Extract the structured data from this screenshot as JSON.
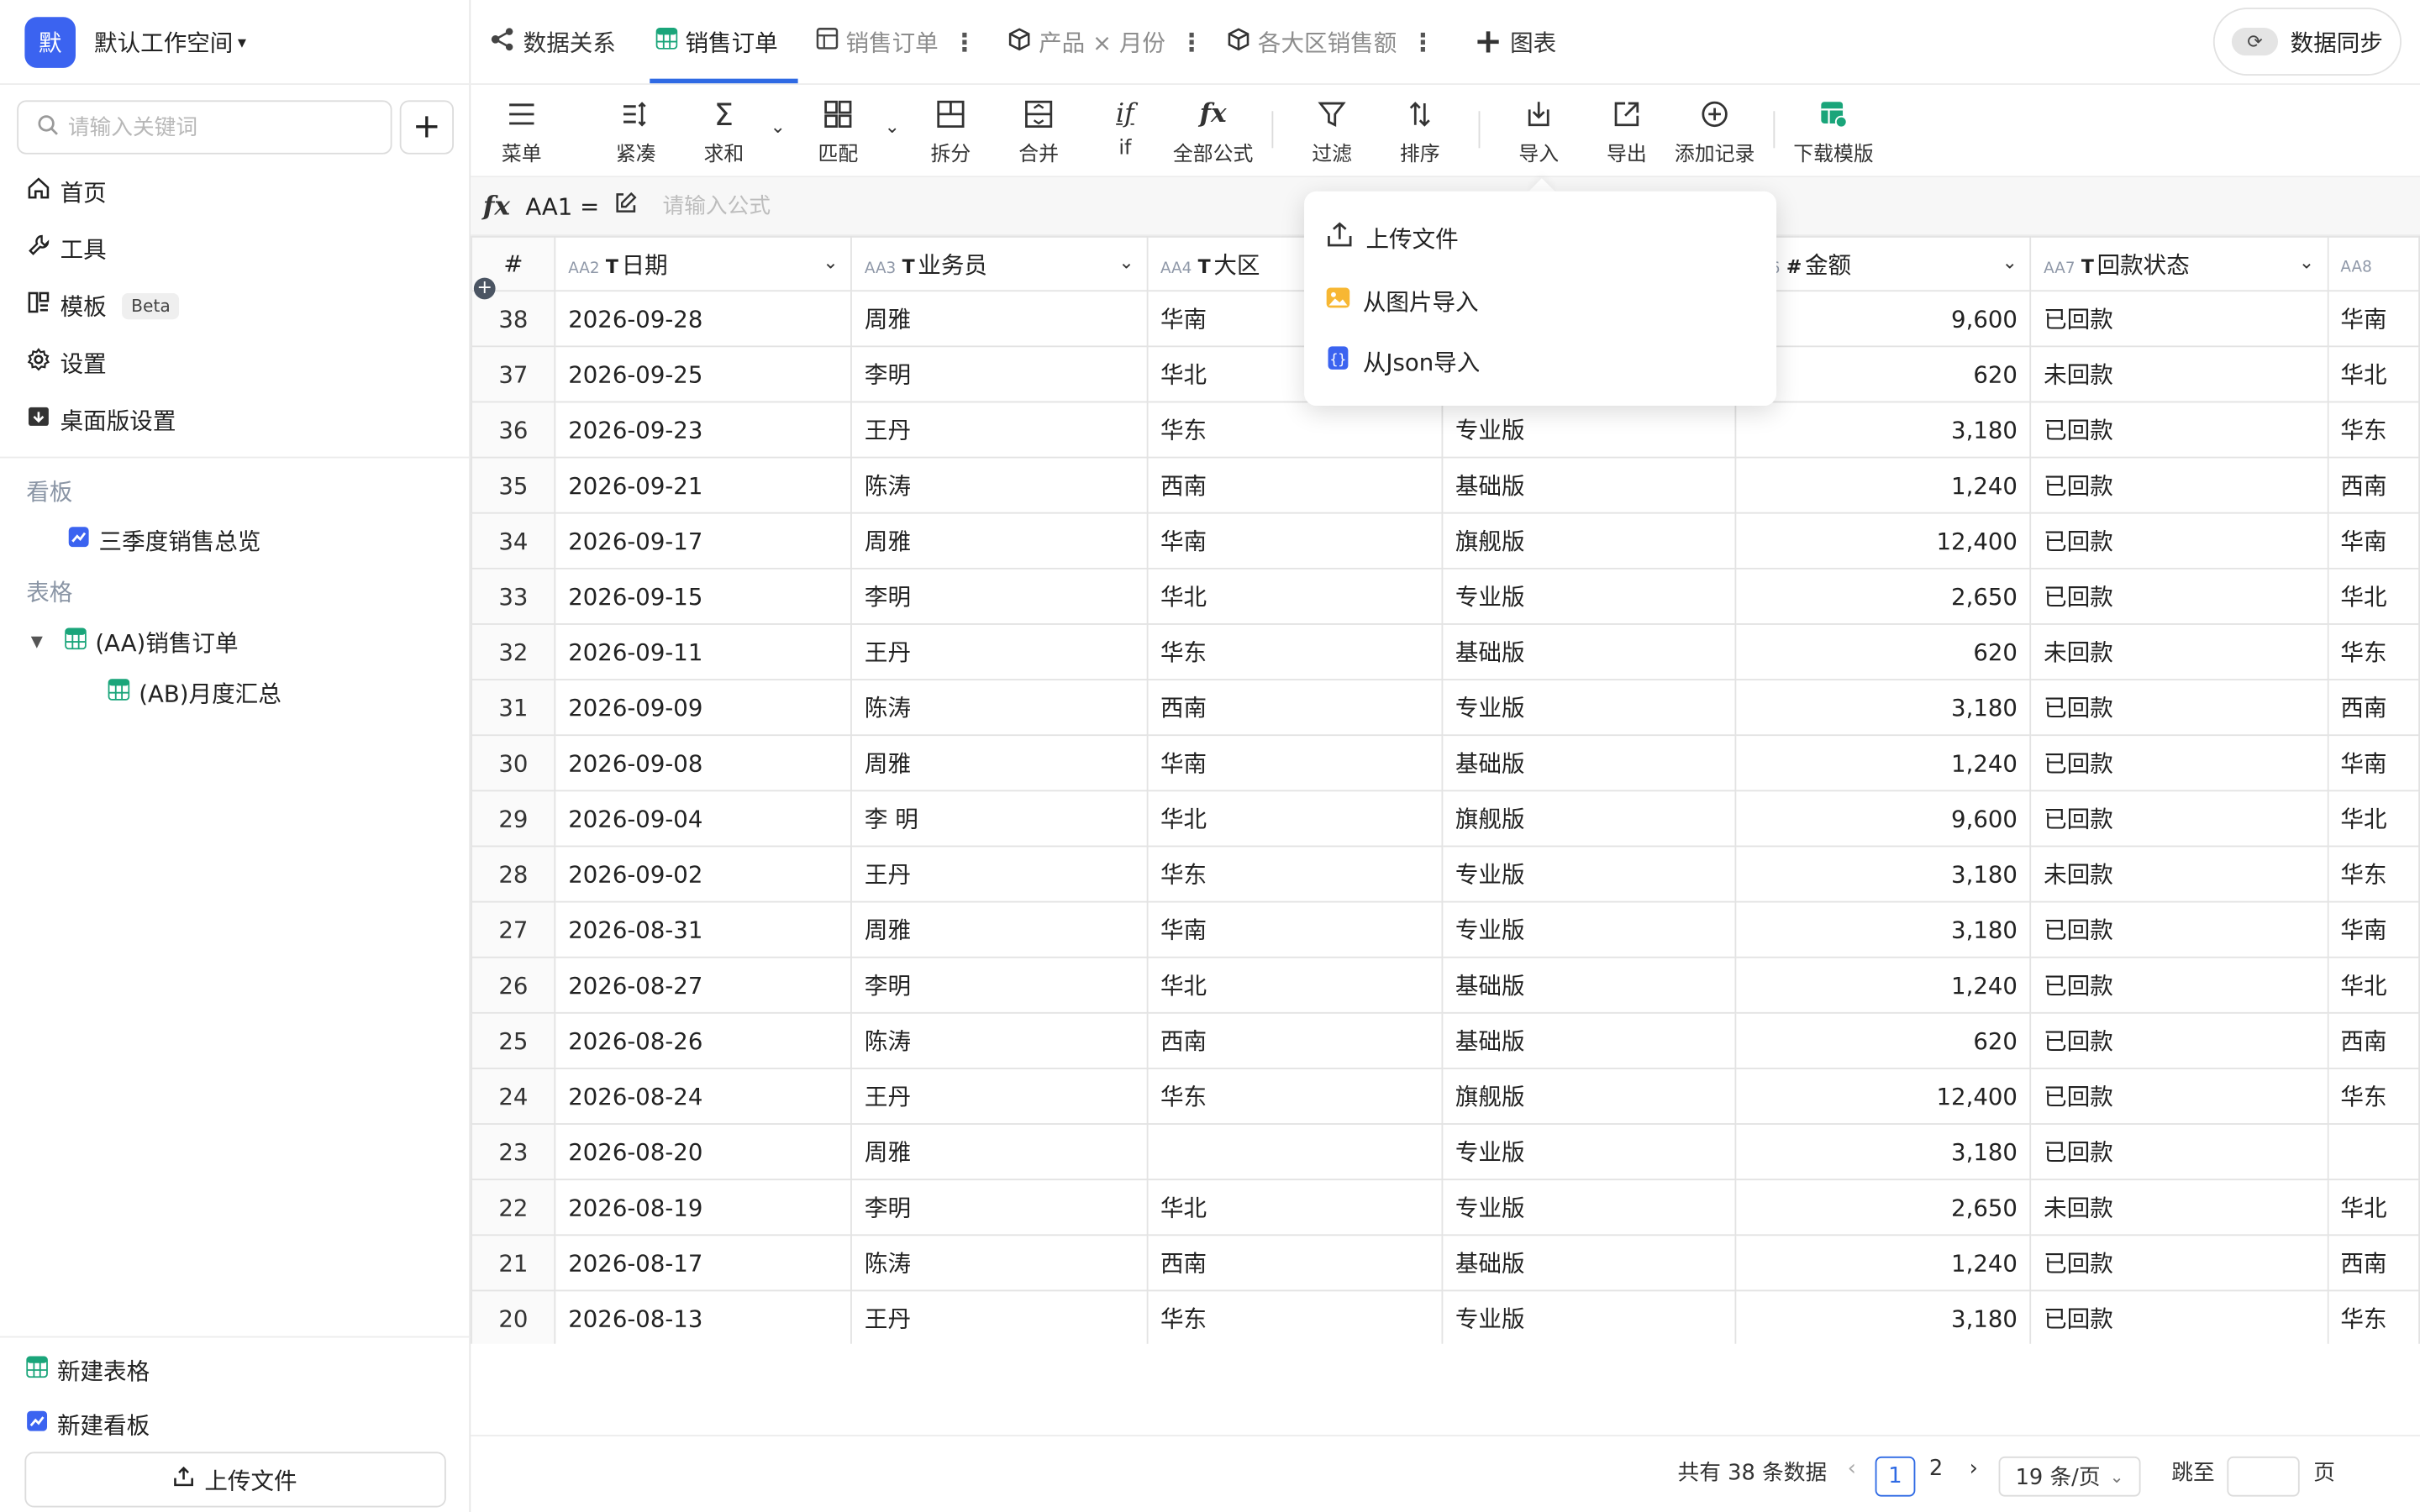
{
  "workspace": {
    "avatar": "默",
    "name": "默认工作空间"
  },
  "search": {
    "placeholder": "请输入关键词"
  },
  "nav": [
    {
      "icon": "home-icon",
      "label": "首页"
    },
    {
      "icon": "wrench-icon",
      "label": "工具"
    },
    {
      "icon": "template-icon",
      "label": "模板",
      "badge": "Beta"
    },
    {
      "icon": "gear-icon",
      "label": "设置"
    },
    {
      "icon": "desktop-settings-icon",
      "label": "桌面版设置"
    }
  ],
  "sections": {
    "boards_title": "看板",
    "boards": [
      {
        "label": "三季度销售总览"
      }
    ],
    "tables_title": "表格",
    "tables": [
      {
        "label": "(AA)销售订单"
      },
      {
        "label": "(AB)月度汇总"
      }
    ]
  },
  "sidebar_bottom": {
    "new_table": "新建表格",
    "new_board": "新建看板",
    "upload": "上传文件"
  },
  "tabs": [
    {
      "label": "数据关系",
      "icon": "relation-icon"
    },
    {
      "label": "销售订单",
      "icon": "table-icon",
      "active": true
    },
    {
      "label": "销售订单",
      "icon": "view-icon"
    },
    {
      "label": "产品 × 月份",
      "icon": "cube-icon"
    },
    {
      "label": "各大区销售额",
      "icon": "cube-icon"
    },
    {
      "label": "图表",
      "icon": "plus-icon"
    }
  ],
  "sync_label": "数据同步",
  "toolbar": [
    {
      "label": "菜单",
      "icon": "menu-icon"
    },
    {
      "label": "紧凑",
      "icon": "compact-icon"
    },
    {
      "label": "求和",
      "icon": "sum-icon"
    },
    {
      "label": "匹配",
      "icon": "match-icon"
    },
    {
      "label": "拆分",
      "icon": "split-icon"
    },
    {
      "label": "合并",
      "icon": "merge-icon"
    },
    {
      "label": "if",
      "icon": "if-icon"
    },
    {
      "label": "全部公式",
      "icon": "fx-icon"
    },
    {
      "label": "过滤",
      "icon": "filter-icon"
    },
    {
      "label": "排序",
      "icon": "sort-icon"
    },
    {
      "label": "导入",
      "icon": "import-icon"
    },
    {
      "label": "导出",
      "icon": "export-icon"
    },
    {
      "label": "添加记录",
      "icon": "add-record-icon"
    },
    {
      "label": "下载模版",
      "icon": "download-template-icon"
    }
  ],
  "formula": {
    "cell": "AA1 =",
    "placeholder": "请输入公式"
  },
  "columns": [
    {
      "id": "AA2",
      "type": "T",
      "name": "日期"
    },
    {
      "id": "AA3",
      "type": "T",
      "name": "业务员"
    },
    {
      "id": "AA4",
      "type": "T",
      "name": "大区"
    },
    {
      "id": "",
      "type": "",
      "name": ""
    },
    {
      "id": "AA6",
      "type": "#",
      "name": "金额"
    },
    {
      "id": "AA7",
      "type": "T",
      "name": "回款状态"
    },
    {
      "id": "AA8",
      "type": "",
      "name": ""
    }
  ],
  "rows": [
    [
      "38",
      "2026-09-28",
      "周雅",
      "华南",
      "",
      "9,600",
      "已回款",
      "华南"
    ],
    [
      "37",
      "2026-09-25",
      "李明",
      "华北",
      "",
      "620",
      "未回款",
      "华北"
    ],
    [
      "36",
      "2026-09-23",
      "王丹",
      "华东",
      "专业版",
      "3,180",
      "已回款",
      "华东"
    ],
    [
      "35",
      "2026-09-21",
      "陈涛",
      "西南",
      "基础版",
      "1,240",
      "已回款",
      "西南"
    ],
    [
      "34",
      "2026-09-17",
      "周雅",
      "华南",
      "旗舰版",
      "12,400",
      "已回款",
      "华南"
    ],
    [
      "33",
      "2026-09-15",
      "李明",
      "华北",
      "专业版",
      "2,650",
      "已回款",
      "华北"
    ],
    [
      "32",
      "2026-09-11",
      "王丹",
      "华东",
      "基础版",
      "620",
      "未回款",
      "华东"
    ],
    [
      "31",
      "2026-09-09",
      "陈涛",
      "西南",
      "专业版",
      "3,180",
      "已回款",
      "西南"
    ],
    [
      "30",
      "2026-09-08",
      "周雅",
      "华南",
      "基础版",
      "1,240",
      "已回款",
      "华南"
    ],
    [
      "29",
      "2026-09-04",
      "李 明",
      "华北",
      "旗舰版",
      "9,600",
      "已回款",
      "华北"
    ],
    [
      "28",
      "2026-09-02",
      "王丹",
      "华东",
      "专业版",
      "3,180",
      "未回款",
      "华东"
    ],
    [
      "27",
      "2026-08-31",
      "周雅",
      "华南",
      "专业版",
      "3,180",
      "已回款",
      "华南"
    ],
    [
      "26",
      "2026-08-27",
      "李明",
      "华北",
      "基础版",
      "1,240",
      "已回款",
      "华北"
    ],
    [
      "25",
      "2026-08-26",
      "陈涛",
      "西南",
      "基础版",
      "620",
      "已回款",
      "西南"
    ],
    [
      "24",
      "2026-08-24",
      "王丹",
      "华东",
      "旗舰版",
      "12,400",
      "已回款",
      "华东"
    ],
    [
      "23",
      "2026-08-20",
      "周雅",
      "",
      "专业版",
      "3,180",
      "已回款",
      ""
    ],
    [
      "22",
      "2026-08-19",
      "李明",
      "华北",
      "专业版",
      "2,650",
      "未回款",
      "华北"
    ],
    [
      "21",
      "2026-08-17",
      "陈涛",
      "西南",
      "基础版",
      "1,240",
      "已回款",
      "西南"
    ],
    [
      "20",
      "2026-08-13",
      "王丹",
      "华东",
      "专业版",
      "3,180",
      "已回款",
      "华东"
    ]
  ],
  "import_menu": [
    {
      "label": "上传文件",
      "icon": "upload-icon"
    },
    {
      "label": "从图片导入",
      "icon": "image-icon"
    },
    {
      "label": "从Json导入",
      "icon": "json-icon"
    }
  ],
  "pagination": {
    "total": "共有 38 条数据",
    "current": "1",
    "page2": "2",
    "page_size": "19 条/页",
    "jump_label": "跳至",
    "page_suffix": "页"
  },
  "colors": {
    "accent": "#2f6ae4",
    "avatar": "#3b63f0",
    "table_icon": "#1aa57a",
    "board_icon": "#3b63f0"
  }
}
